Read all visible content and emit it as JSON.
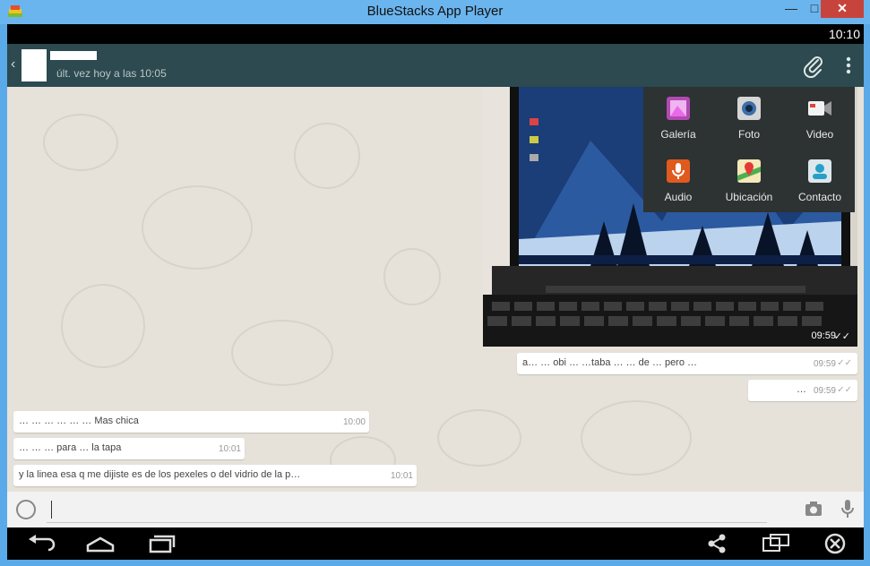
{
  "window": {
    "title": "BlueStacks App Player",
    "minimize": "—",
    "maximize": "□",
    "close": "✕"
  },
  "status_bar": {
    "time": "10:10"
  },
  "chat_header": {
    "back_glyph": "‹",
    "last_seen": "últ. vez hoy a las 10:05",
    "icons": [
      "paperclip-icon",
      "overflow-menu-icon"
    ]
  },
  "image_message": {
    "time": "09:59",
    "ticks": "✓✓"
  },
  "messages": [
    {
      "direction": "out",
      "text": "a… … obi … …taba … … de … pero …",
      "time": "09:59",
      "ticks": "✓✓"
    },
    {
      "direction": "out",
      "text": "…",
      "time": "09:59",
      "ticks": "✓✓"
    },
    {
      "direction": "in",
      "text": "… … … … … … Mas chica",
      "time": "10:00"
    },
    {
      "direction": "in",
      "text": "… … … para … la tapa",
      "time": "10:01"
    },
    {
      "direction": "in",
      "text": "y la linea esa q me dijiste es de los pexeles o del vidrio de la p…",
      "time": "10:01"
    }
  ],
  "attach_menu": [
    {
      "label": "Galería",
      "icon": "gallery-icon",
      "color": "#b24ab2"
    },
    {
      "label": "Foto",
      "icon": "camera-icon",
      "color": "#3f6ea8"
    },
    {
      "label": "Video",
      "icon": "video-icon",
      "color": "#e0423a"
    },
    {
      "label": "Audio",
      "icon": "microphone-icon",
      "color": "#e05a1e"
    },
    {
      "label": "Ubicación",
      "icon": "map-pin-icon",
      "color": "#4caf50"
    },
    {
      "label": "Contacto",
      "icon": "contact-card-icon",
      "color": "#27a0c7"
    }
  ],
  "input": {
    "placeholder": ""
  },
  "nav_bar": {
    "buttons": [
      "back-icon",
      "home-icon",
      "recents-icon",
      "share-icon",
      "rotate-screen-icon",
      "close-app-icon"
    ]
  }
}
